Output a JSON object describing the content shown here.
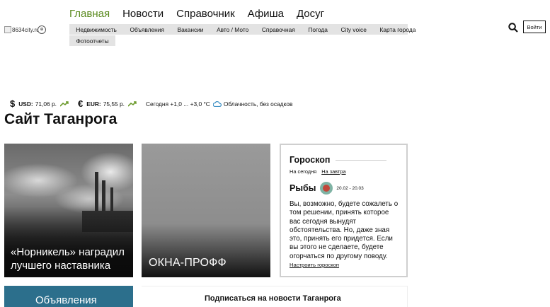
{
  "header": {
    "logo_alt": "8634city.ru",
    "main_nav": [
      "Главная",
      "Новости",
      "Справочник",
      "Афиша",
      "Досуг"
    ],
    "sub_nav_row1": [
      "Недвижимость",
      "Объявления",
      "Вакансии",
      "Авто / Мото",
      "Справочная",
      "Погода",
      "City voice",
      "Карта города"
    ],
    "sub_nav_row2": [
      "Фотоотчеты"
    ],
    "login_label": "Войти",
    "colors": {
      "active_nav": "#5a8a1e",
      "subnav_bg": "#e3e3e3"
    }
  },
  "info_bar": {
    "usd_label": "USD:",
    "usd_value": "71,06 р.",
    "eur_label": "EUR:",
    "eur_value": "75,55 р.",
    "weather_temp": "Сегодня +1,0 ... +3,0 °C",
    "weather_desc": "Облачность, без осадков"
  },
  "page_title": "Сайт Таганрога",
  "cards": [
    {
      "text": "«Норникель» наградил лучшего наставника"
    },
    {
      "text": "ОКНА-ПРОФФ"
    }
  ],
  "horoscope": {
    "title": "Гороскоп",
    "tab_today": "На сегодня",
    "tab_tomorrow": "На завтра",
    "sign": "Рыбы",
    "dates": "20.02 - 20.03",
    "text": "Вы, возможно, будете сожалеть о том решении, принять которое вас сегодня вынудят обстоятельства. Но, даже зная это, принять его придется. Если вы этого не сделаете, будете огорчаться по другому поводу.",
    "configure_label": "Настроить гороскоп"
  },
  "bottom": {
    "card_label": "Объявления",
    "subscribe_text": "Подписаться на новости Таганрога"
  }
}
